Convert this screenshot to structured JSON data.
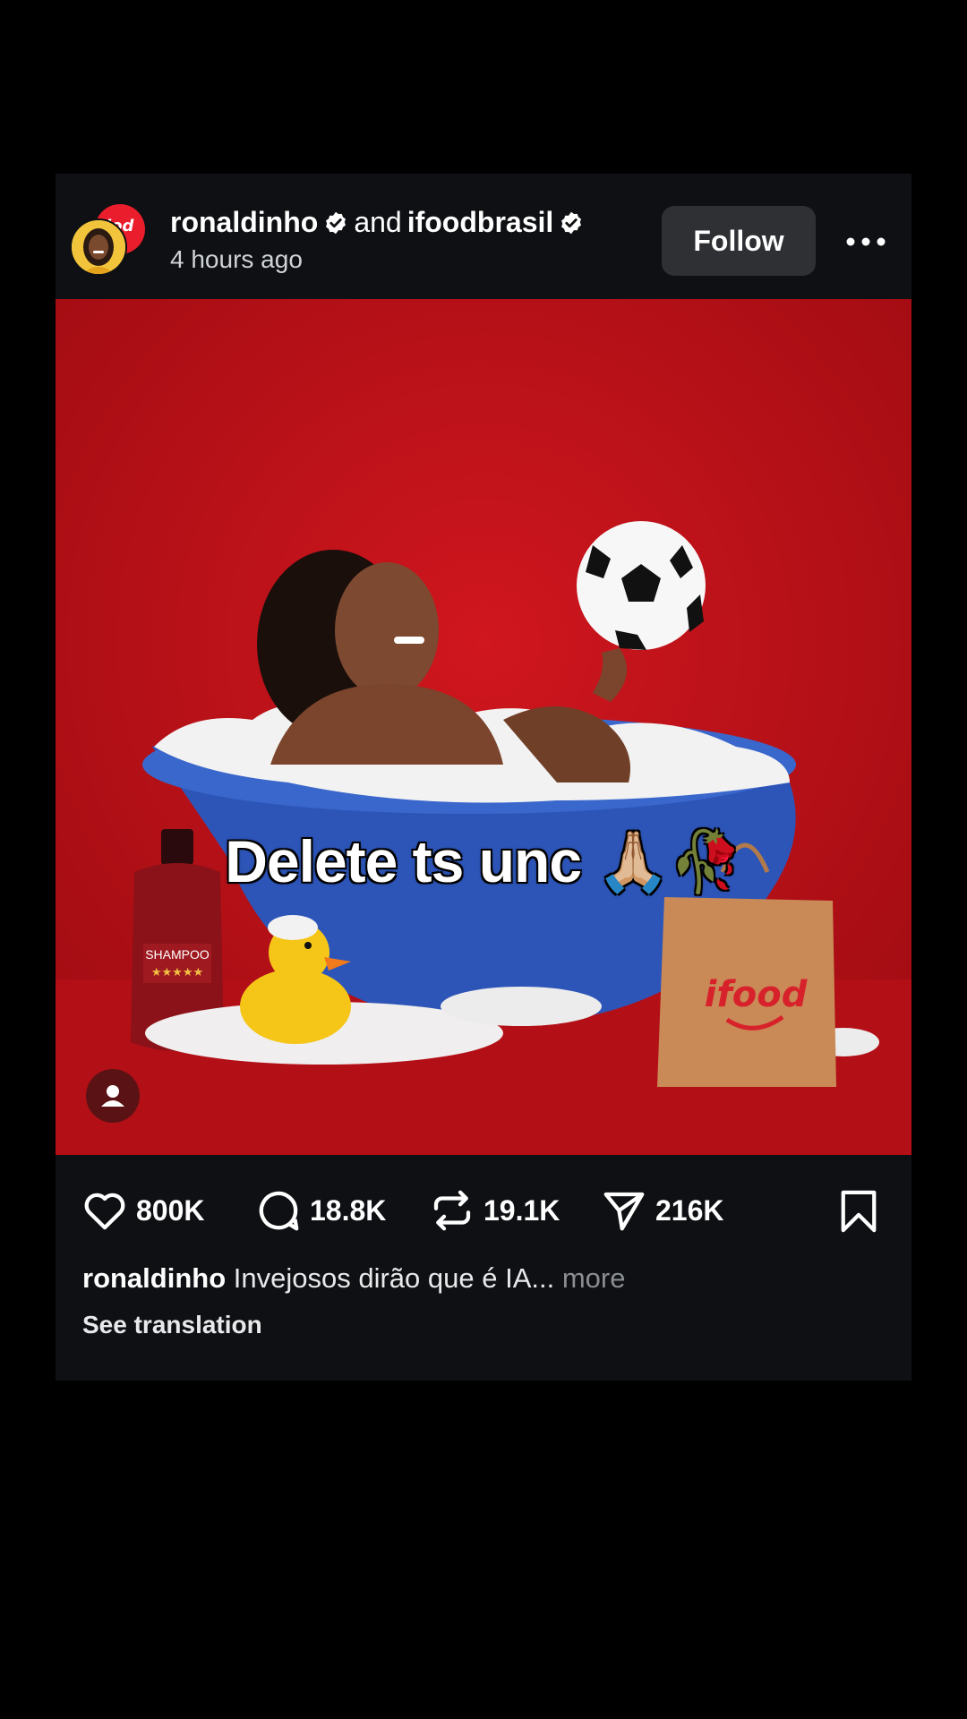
{
  "post": {
    "author1": "ronaldinho",
    "joiner": "and",
    "author2": "ifoodbrasil",
    "time": "4 hours ago",
    "follow_label": "Follow",
    "avatar_back_text": "iod",
    "overlay_text": "Delete ts unc 🙏🏼🥀",
    "bottle_label": "SHAMPOO",
    "bottle_stars": "★★★★★",
    "bag_brand": "ifood"
  },
  "actions": {
    "likes": "800K",
    "comments": "18.8K",
    "reposts": "19.1K",
    "shares": "216K"
  },
  "caption": {
    "username": "ronaldinho",
    "text": "Invejosos dirão que é IA...",
    "more": "more",
    "translation": "See translation"
  },
  "colors": {
    "background": "#000000",
    "card": "#0e1013",
    "photo_bg": "#c2121a",
    "ifood_red": "#ea1d2c",
    "follow_bg": "#2e3034"
  },
  "icons": [
    "verified-badge-icon",
    "more-options-icon",
    "heart-icon",
    "comment-icon",
    "repost-icon",
    "share-icon",
    "bookmark-icon",
    "user-tag-icon"
  ]
}
